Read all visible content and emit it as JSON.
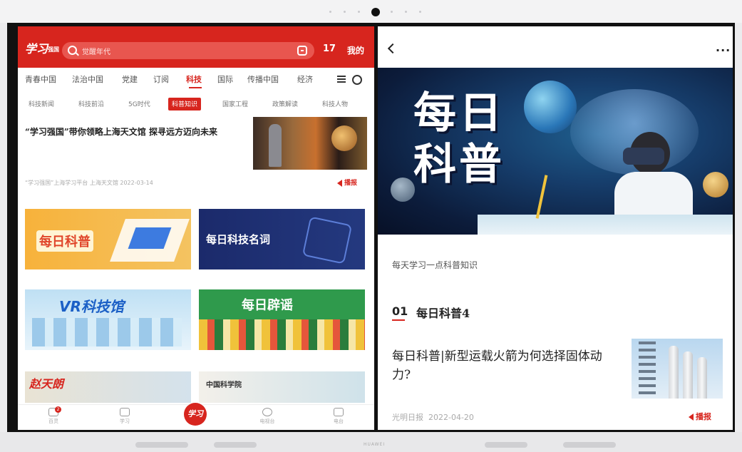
{
  "left_app": {
    "logo": "学习",
    "logo_small": "强国",
    "search_placeholder": "觉醒年代",
    "score": "17",
    "mine_label": "我的",
    "tabs": [
      "青春中国",
      "法治中国",
      "党建",
      "订阅",
      "科技",
      "国际",
      "传播中国",
      "经济"
    ],
    "active_tab": "科技",
    "subtabs": [
      "科技新闻",
      "科技前沿",
      "5G时代",
      "科普知识",
      "国家工程",
      "政策解读",
      "科技人物"
    ],
    "active_subtab": "科普知识",
    "news": {
      "title": "“学习强国”带你领略上海天文馆 探寻远方迈向未来",
      "meta": "“学习强国”上海学习平台 上海天文馆 2022-03-14",
      "play_label": "播报"
    },
    "banners": [
      "每日科普",
      "每日科技名词",
      "VR科技馆",
      "每日辟谣",
      "赵天朗",
      "中国科学院"
    ],
    "bottom_nav": [
      "百灵",
      "学习",
      "",
      "电视台",
      "电台"
    ],
    "center_label": "学习",
    "badge": "2"
  },
  "right_app": {
    "hero_title": "每日科普",
    "subtitle": "每天学习一点科普知识",
    "section_number": "01",
    "section_title": "每日科普4",
    "article": {
      "title": "每日科普|新型运载火箭为何选择固体动力?",
      "source": "光明日报",
      "date": "2022-04-20",
      "play_label": "播报"
    }
  },
  "device": {
    "brand": "HUAWEI"
  },
  "colors": {
    "accent": "#d7251e",
    "hero_bg": "#163d6b"
  }
}
